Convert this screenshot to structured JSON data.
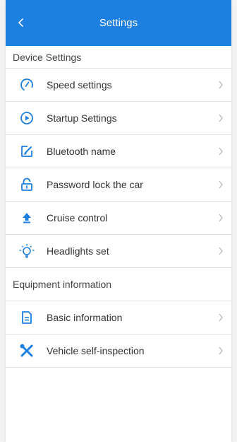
{
  "header": {
    "title": "Settings",
    "back_icon": "chevron-left-icon",
    "color": "#1d7fe0"
  },
  "accent_color": "#1d7fe0",
  "sections": [
    {
      "title": "Device Settings",
      "items": [
        {
          "label": "Speed settings",
          "icon": "speedometer-icon"
        },
        {
          "label": "Startup Settings",
          "icon": "play-circle-icon"
        },
        {
          "label": "Bluetooth name",
          "icon": "edit-icon"
        },
        {
          "label": "Password lock the car",
          "icon": "lock-icon"
        },
        {
          "label": "Cruise control",
          "icon": "arrow-up-icon"
        },
        {
          "label": "Headlights set",
          "icon": "lightbulb-icon"
        }
      ]
    },
    {
      "title": "Equipment information",
      "items": [
        {
          "label": "Basic information",
          "icon": "document-icon"
        },
        {
          "label": "Vehicle self-inspection",
          "icon": "tools-icon"
        }
      ]
    }
  ]
}
